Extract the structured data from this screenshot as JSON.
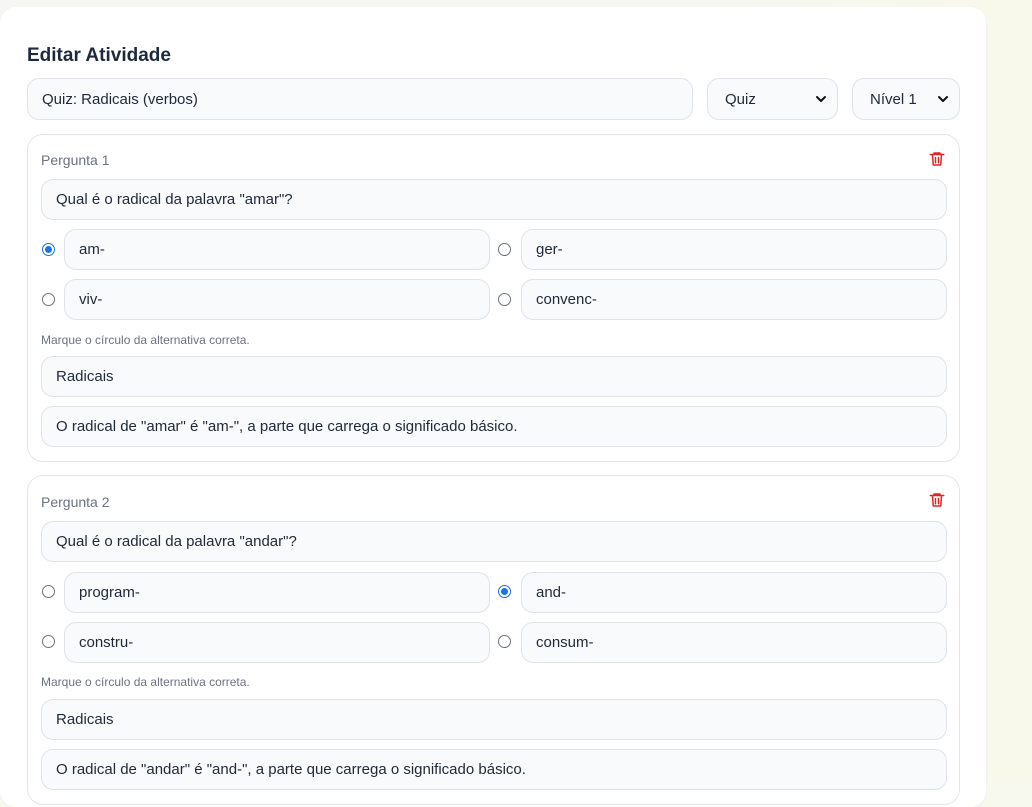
{
  "header": {
    "title": "Editar Atividade"
  },
  "activity": {
    "name": "Quiz: Radicais (verbos)",
    "type_selected": "Quiz",
    "level_selected": "Nível 1"
  },
  "icons": {
    "delete": "trash-icon",
    "dropdown": "chevron-down-icon"
  },
  "colors": {
    "accent": "#1a73e8",
    "danger": "#dc2626"
  },
  "questions": [
    {
      "label": "Pergunta 1",
      "text": "Qual é o radical da palavra \"amar\"?",
      "options": [
        "am-",
        "ger-",
        "viv-",
        "convenc-"
      ],
      "correct_index": 0,
      "hint": "Marque o círculo da alternativa correta.",
      "topic": "Radicais",
      "explanation": "O radical de \"amar\" é \"am-\", a parte que carrega o significado básico."
    },
    {
      "label": "Pergunta 2",
      "text": "Qual é o radical da palavra \"andar\"?",
      "options": [
        "program-",
        "and-",
        "constru-",
        "consum-"
      ],
      "correct_index": 1,
      "hint": "Marque o círculo da alternativa correta.",
      "topic": "Radicais",
      "explanation": "O radical de \"andar\" é \"and-\", a parte que carrega o significado básico."
    }
  ]
}
